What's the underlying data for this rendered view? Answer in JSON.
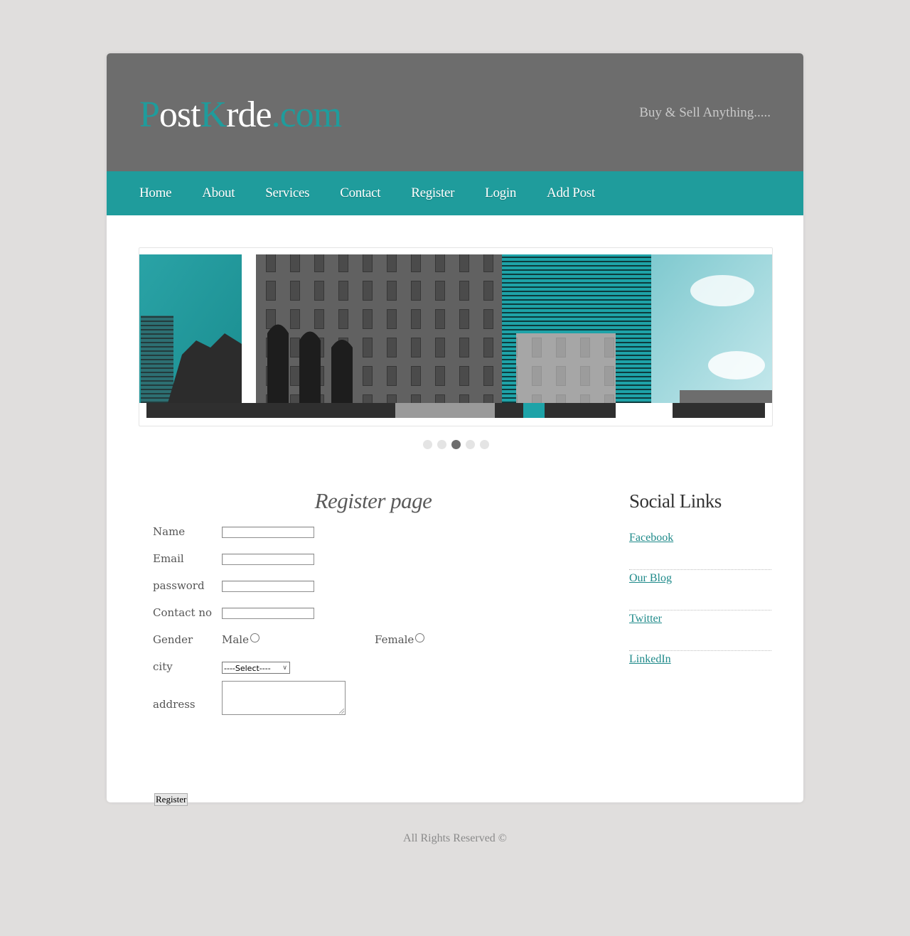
{
  "logo": {
    "part1": "P",
    "part2": "ost",
    "part3": "K",
    "part4": "rde",
    "part5": ".com"
  },
  "slogan": "Buy & Sell Anything.....",
  "nav": [
    {
      "label": "Home"
    },
    {
      "label": "About"
    },
    {
      "label": "Services"
    },
    {
      "label": "Contact"
    },
    {
      "label": "Register"
    },
    {
      "label": "Login"
    },
    {
      "label": "Add Post"
    }
  ],
  "slider": {
    "active_dot": 3,
    "dot_count": 5
  },
  "form": {
    "title": "Register page",
    "name_label": "Name",
    "email_label": "Email",
    "password_label": "password",
    "contact_label": "Contact no",
    "gender_label": "Gender",
    "male_label": "Male",
    "female_label": "Female",
    "city_label": "city",
    "city_selected": "----Select----",
    "address_label": "address",
    "submit_label": "Register"
  },
  "sidebar": {
    "title": "Social Links",
    "links": [
      {
        "label": "Facebook"
      },
      {
        "label": "Our Blog"
      },
      {
        "label": "Twitter"
      },
      {
        "label": "LinkedIn"
      }
    ]
  },
  "footer": "All Rights Reserved ©",
  "colors": {
    "accent": "#1f9c9c",
    "header": "#6d6d6d",
    "background": "#e0dedd"
  }
}
